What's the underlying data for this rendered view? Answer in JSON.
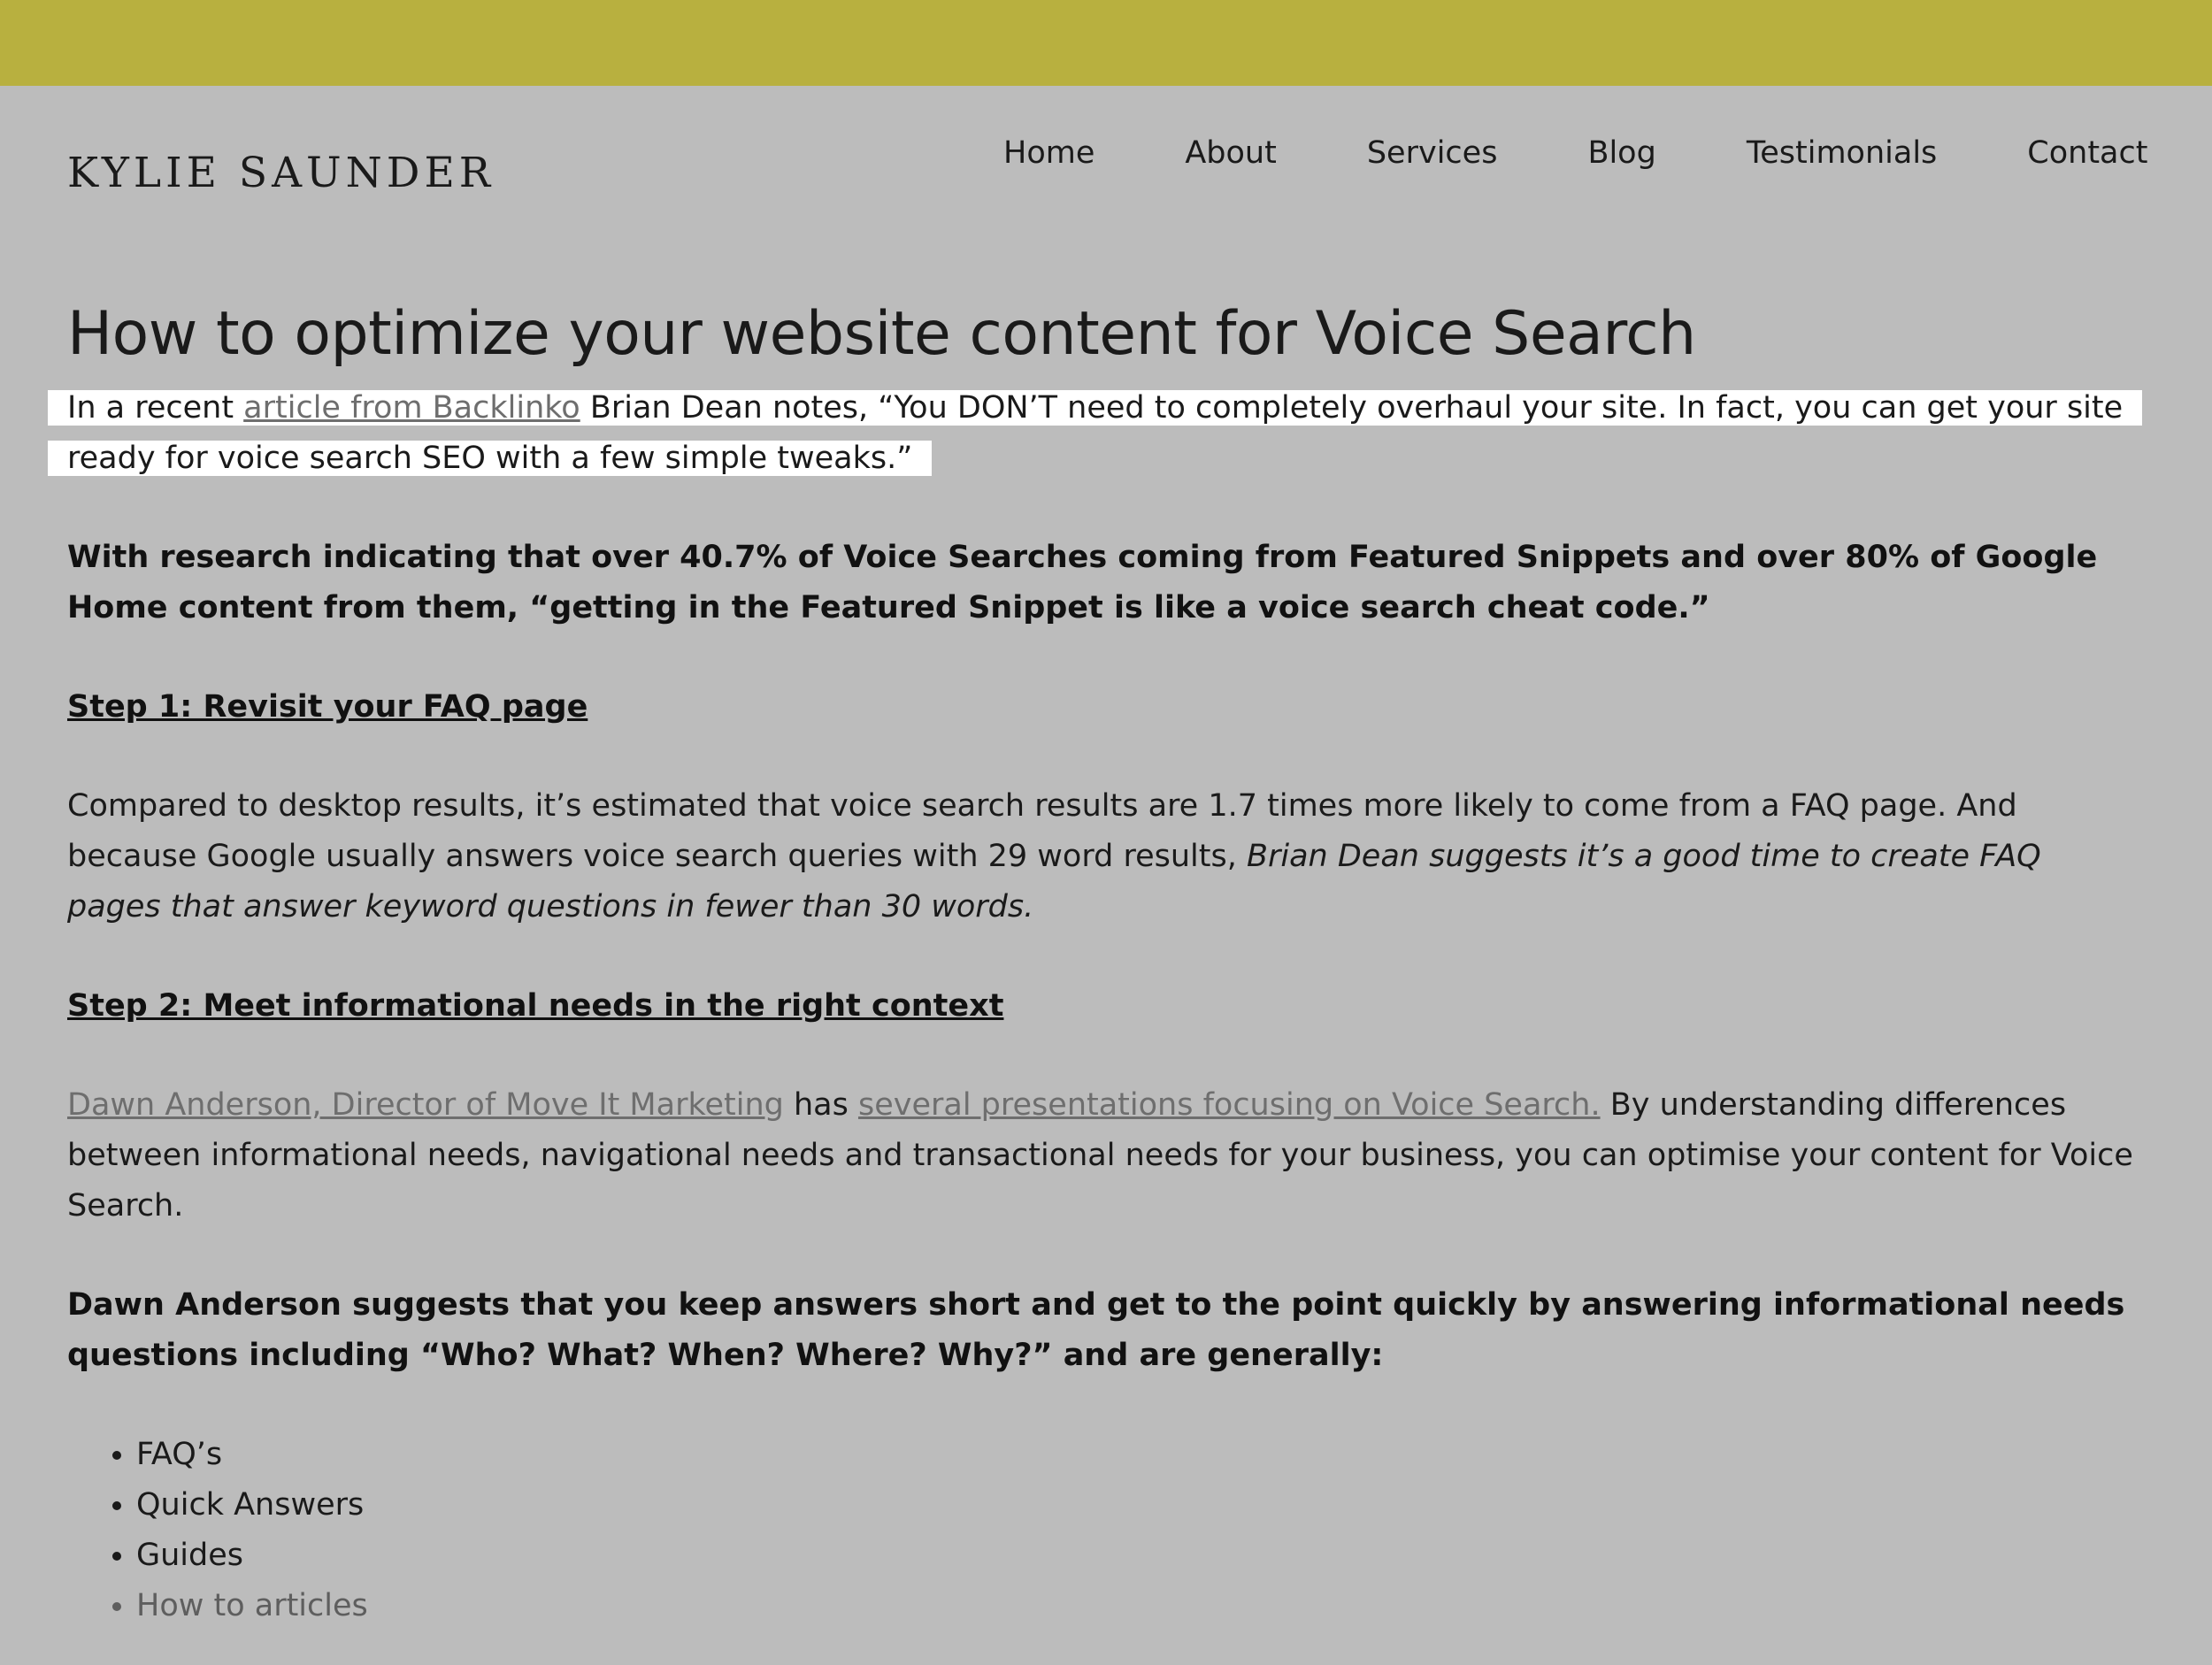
{
  "site": {
    "title": "KYLIE SAUNDER"
  },
  "nav": {
    "items": [
      "Home",
      "About",
      "Services",
      "Blog",
      "Testimonials",
      "Contact"
    ]
  },
  "post": {
    "title": "How to optimize your website content for Voice Search",
    "intro": {
      "lead": "In a recent ",
      "link": "article from Backlinko",
      "rest": " Brian Dean notes, “You DON’T need to completely overhaul your site. In fact, you can get your site ready for voice search SEO with a few simple tweaks.”"
    },
    "research": "With research indicating that over 40.7% of Voice Searches coming from Featured Snippets and over 80% of Google Home content from them, “getting in the Featured Snippet is like a voice search cheat code.”",
    "step1": {
      "heading": "Step 1: Revisit your FAQ page",
      "text": "Compared to desktop results, it’s estimated that voice search results are 1.7 times more likely to come from a FAQ page. And because Google usually answers voice search queries with 29 word results, ",
      "italic": "Brian Dean suggests it’s a good time to create FAQ pages that answer keyword questions in fewer than 30 words."
    },
    "step2": {
      "heading": "Step 2: Meet informational needs in the right context",
      "link1": "Dawn Anderson, Director of Move It Marketing",
      "mid": " has ",
      "link2": "several presentations focusing on Voice Search.",
      "rest": " By understanding differences between informational needs, navigational needs and transactional needs for your business, you can optimise your content for Voice Search."
    },
    "suggestion": "Dawn Anderson suggests that you keep answers short and get to the point quickly by answering informational needs questions including “Who? What? When? Where? Why?” and are generally:",
    "list": [
      "FAQ’s",
      "Quick Answers",
      "Guides",
      "How to articles"
    ]
  },
  "colors": {
    "top_bar": "#b8b03f",
    "background": "#bcbcbc",
    "link": "#6e6e6e",
    "highlight": "#ffffff"
  }
}
